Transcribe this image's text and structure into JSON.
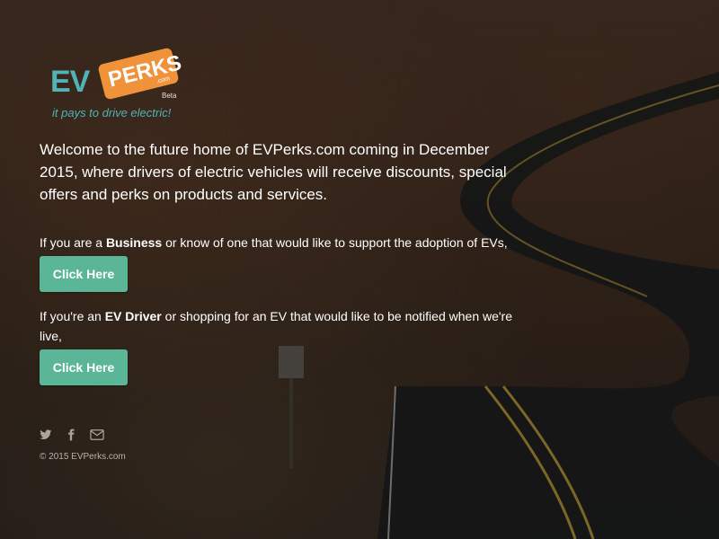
{
  "logo": {
    "ev": "EV",
    "perks": "PERKS",
    "com": ".com",
    "beta": "Beta",
    "tagline": "it pays to drive electric!"
  },
  "intro": "Welcome to the future home of EVPerks.com coming in December 2015, where drivers of electric vehicles will receive discounts, special offers and perks on products and services.",
  "business": {
    "text_before": "If you are a ",
    "highlight": "Business",
    "text_after": " or know of one that would like to support the adoption of EVs,",
    "button_label": "Click Here"
  },
  "driver": {
    "text_before": "If you're an ",
    "highlight": "EV Driver",
    "text_after": " or shopping for an EV that would like to be notified when we're live,",
    "button_label": "Click Here"
  },
  "social": {
    "icons": [
      "twitter-icon",
      "facebook-icon",
      "email-icon"
    ]
  },
  "footer": {
    "copyright": "© 2015 EVPerks.com"
  },
  "colors": {
    "button": "#5bb597",
    "logo_teal": "#4fb3b7",
    "logo_orange": "#f0923a"
  }
}
